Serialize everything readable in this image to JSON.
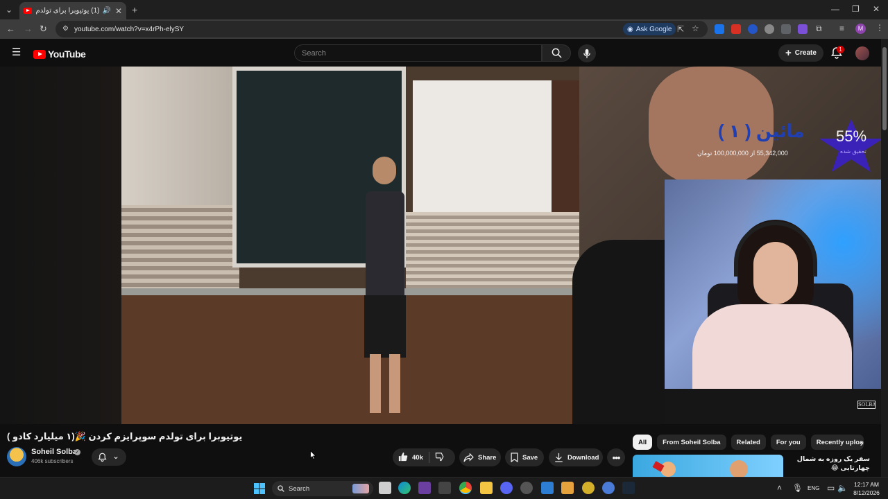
{
  "browser": {
    "tab_title": "(1) یوتیوبرا برای تولدم سوپرایزم کردن",
    "url": "youtube.com/watch?v=x4rPh-elySY",
    "ask_google": "Ask Google"
  },
  "youtube": {
    "logo_text": "YouTube",
    "search_placeholder": "Search",
    "create_label": "Create",
    "notification_count": "1"
  },
  "video": {
    "overlay": {
      "donor_name": "مائین ( ۱ )",
      "progress_line": "55,342,000 از 100,000,000 تومان",
      "percent": "55%",
      "percent_sub": "تحقیق شده",
      "watermark": "SOLBA"
    },
    "title": "یوتیوبرا برای تولدم سوپرایزم کردن 🎉(۱ میلیارد کادو )",
    "channel_name": "Soheil Solba",
    "channel_verified": "✓",
    "subscribers": "406k subscribers",
    "likes": "40k",
    "share_label": "Share",
    "save_label": "Save",
    "download_label": "Download"
  },
  "sidebar": {
    "chips": [
      {
        "label": "All",
        "active": true
      },
      {
        "label": "From Soheil Solba",
        "active": false
      },
      {
        "label": "Related",
        "active": false
      },
      {
        "label": "For you",
        "active": false
      },
      {
        "label": "Recently upload",
        "active": false
      }
    ],
    "recommendation_title": "سفر یک روزه به شمال چهارتایی 😂"
  },
  "taskbar": {
    "search_placeholder": "Search",
    "language": "ENG",
    "time": "12:17 AM",
    "date": "8/12/2026"
  },
  "colors": {
    "background": "#0f0f0f",
    "youtube_red": "#ff0000",
    "chip_active": "#f1f1f1",
    "button_bg": "#272727"
  }
}
